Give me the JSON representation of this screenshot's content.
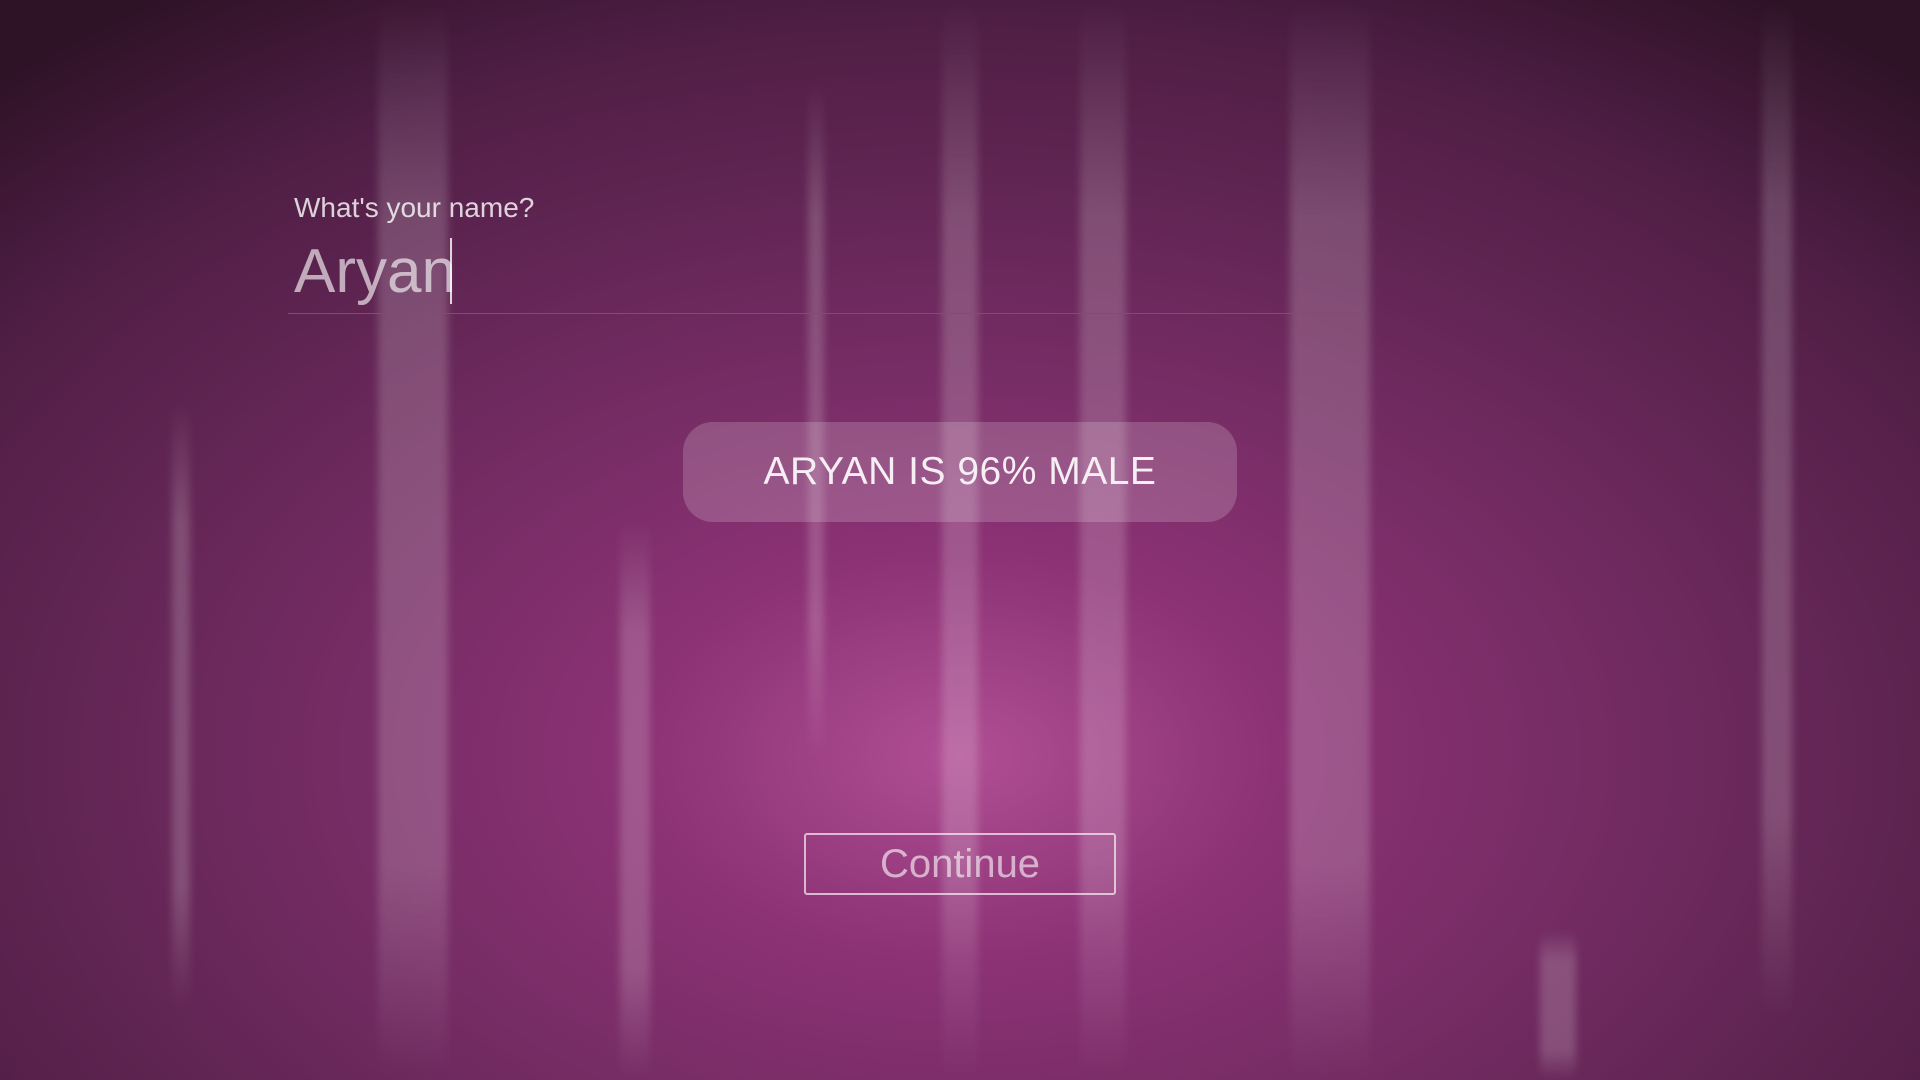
{
  "form": {
    "prompt_label": "What's your name?",
    "name_value": "Aryan"
  },
  "result": {
    "text": "ARYAN IS 96% MALE"
  },
  "actions": {
    "continue_label": "Continue"
  },
  "colors": {
    "background_center": "#b04e94",
    "background_edge": "#2e1226",
    "input_underline": "#3e7a35"
  }
}
